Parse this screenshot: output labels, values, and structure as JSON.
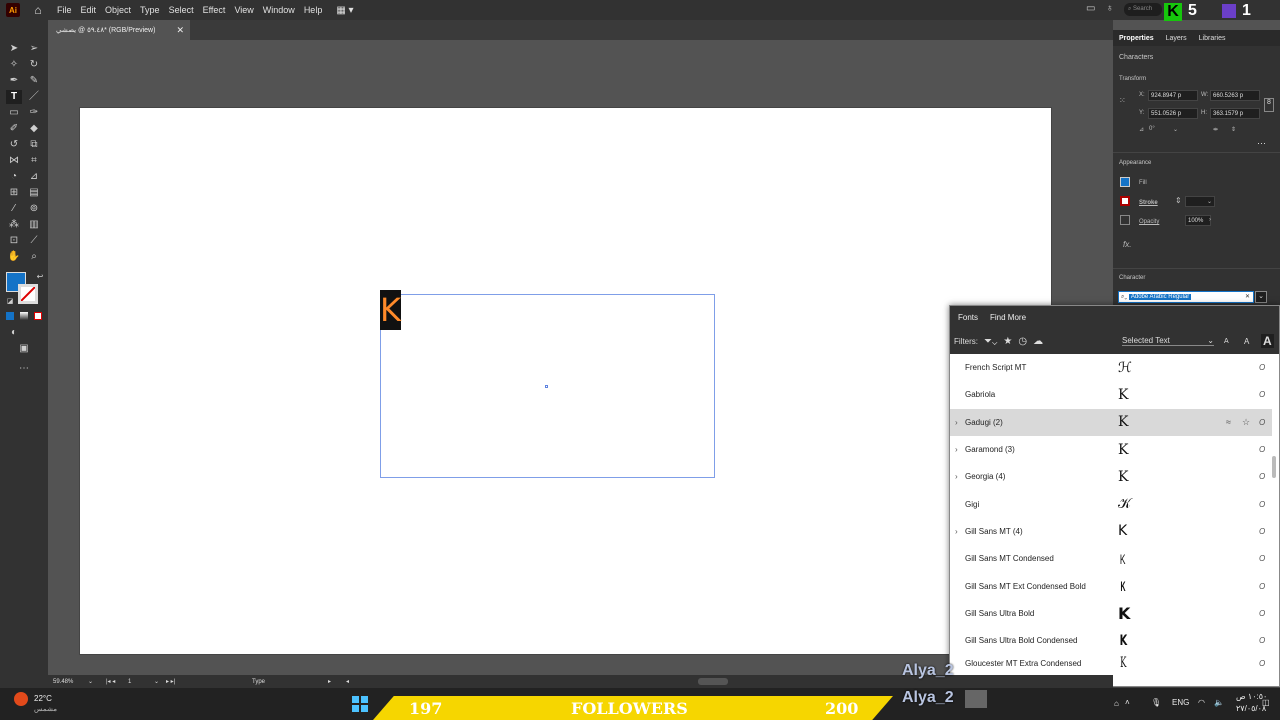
{
  "app": {
    "logo": "Ai",
    "menus": [
      "File",
      "Edit",
      "Object",
      "Type",
      "Select",
      "Effect",
      "View",
      "Window",
      "Help"
    ],
    "search_placeholder": "Search",
    "document_tab": "٥٩.٤٨ @ يصشي* (RGB/Preview)",
    "badge_letter": "K",
    "badge_count_1": "5",
    "badge_count_2": "1"
  },
  "properties": {
    "tabs": [
      "Properties",
      "Layers",
      "Libraries"
    ],
    "section_characters": "Characters",
    "transform_title": "Transform",
    "x_label": "X:",
    "x_value": "924.8947 p",
    "y_label": "Y:",
    "y_value": "551.0526 p",
    "w_label": "W:",
    "w_value": "660.5263 p",
    "h_label": "H:",
    "h_value": "363.1579 p",
    "rotate_value": "0°",
    "appearance_title": "Appearance",
    "fill_label": "Fill",
    "stroke_label": "Stroke",
    "opacity_label": "Opacity",
    "opacity_value": "100%",
    "fx_label": "fx.",
    "character_title": "Character",
    "font_field_value": "Adobe Arabic Regular"
  },
  "fonts_panel": {
    "tab_fonts": "Fonts",
    "tab_find_more": "Find More",
    "filters_label": "Filters:",
    "preview_select": "Selected Text",
    "size_small": "A",
    "size_medium": "A",
    "size_large": "A",
    "rows": [
      {
        "name": "French Script MT",
        "sample": "ℋ",
        "expandable": false
      },
      {
        "name": "Gabriola",
        "sample": "K",
        "expandable": false
      },
      {
        "name": "Gadugi (2)",
        "sample": "K",
        "expandable": true,
        "highlighted": true
      },
      {
        "name": "Garamond (3)",
        "sample": "K",
        "expandable": true
      },
      {
        "name": "Georgia (4)",
        "sample": "K",
        "expandable": true
      },
      {
        "name": "Gigi",
        "sample": "𝒦",
        "expandable": false
      },
      {
        "name": "Gill Sans MT (4)",
        "sample": "K",
        "expandable": true
      },
      {
        "name": "Gill Sans MT Condensed",
        "sample": "K",
        "expandable": false
      },
      {
        "name": "Gill Sans MT Ext Condensed Bold",
        "sample": "K",
        "expandable": false
      },
      {
        "name": "Gill Sans Ultra Bold",
        "sample": "K",
        "expandable": false
      },
      {
        "name": "Gill Sans Ultra Bold Condensed",
        "sample": "K",
        "expandable": false
      },
      {
        "name": "Gloucester MT Extra Condensed",
        "sample": "K",
        "expandable": false
      }
    ]
  },
  "canvas": {
    "glyph": "K"
  },
  "status": {
    "zoom": "59.48%",
    "artboard": "1",
    "tool": "Type"
  },
  "taskbar": {
    "weather_temp": "22°C",
    "weather_desc": "مشمس",
    "followers_left": "197",
    "followers_label": "FOLLOWERS",
    "followers_right": "200",
    "overlay_name_1": "Alya_2",
    "overlay_name_2": "Alya_2",
    "lang": "ENG",
    "time": "١٠:٥٠ ص",
    "date": "٢٧/٠٥/٠٨"
  }
}
